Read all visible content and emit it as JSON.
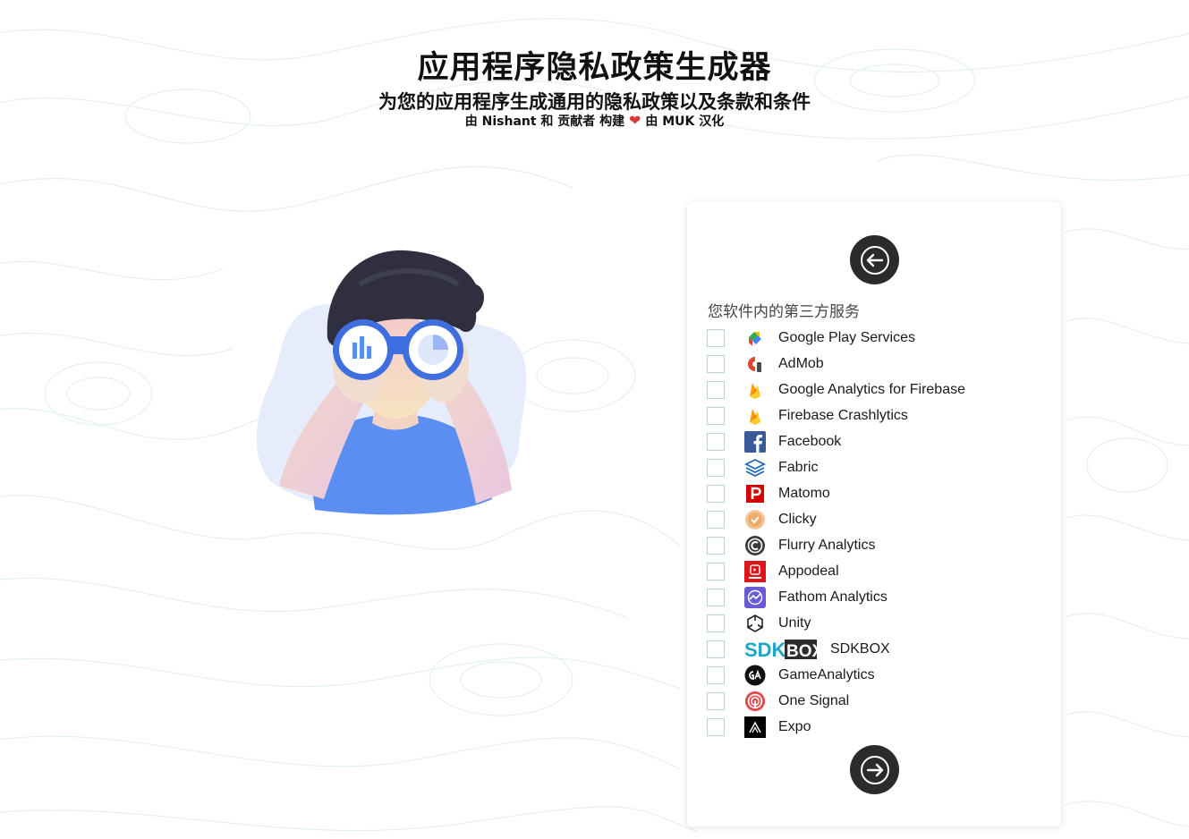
{
  "header": {
    "title": "应用程序隐私政策生成器",
    "subtitle": "为您的应用程序生成通用的隐私政策以及条款和条件",
    "credit_prefix": "由 Nishant 和 贡献者 构建",
    "credit_heart": "❤",
    "credit_suffix": "由 MUK 汉化"
  },
  "card": {
    "back_icon": "arrow-left-icon",
    "next_icon": "arrow-right-icon",
    "section_label": "您软件内的第三方服务",
    "services": [
      {
        "label": "Google Play Services",
        "icon": "google-play-services-icon",
        "checked": false
      },
      {
        "label": "AdMob",
        "icon": "admob-icon",
        "checked": false
      },
      {
        "label": "Google Analytics for Firebase",
        "icon": "firebase-icon",
        "checked": false
      },
      {
        "label": "Firebase Crashlytics",
        "icon": "firebase-icon",
        "checked": false
      },
      {
        "label": "Facebook",
        "icon": "facebook-icon",
        "checked": false
      },
      {
        "label": "Fabric",
        "icon": "fabric-icon",
        "checked": false
      },
      {
        "label": "Matomo",
        "icon": "matomo-icon",
        "checked": false
      },
      {
        "label": "Clicky",
        "icon": "clicky-icon",
        "checked": false
      },
      {
        "label": "Flurry Analytics",
        "icon": "flurry-icon",
        "checked": false
      },
      {
        "label": "Appodeal",
        "icon": "appodeal-icon",
        "checked": false
      },
      {
        "label": "Fathom Analytics",
        "icon": "fathom-icon",
        "checked": false
      },
      {
        "label": "Unity",
        "icon": "unity-icon",
        "checked": false
      },
      {
        "label": "SDKBOX",
        "icon": "sdkbox-logo-icon",
        "logo_text": "SDKBOX",
        "checked": false
      },
      {
        "label": "GameAnalytics",
        "icon": "gameanalytics-icon",
        "checked": false
      },
      {
        "label": "One Signal",
        "icon": "onesignal-icon",
        "checked": false
      },
      {
        "label": "Expo",
        "icon": "expo-icon",
        "checked": false
      }
    ]
  },
  "colors": {
    "nav_button": "#2b2b2b",
    "heart": "#d9383a",
    "checkbox_border": "#b9d3de",
    "topo_lines": "#e4f0f2"
  }
}
